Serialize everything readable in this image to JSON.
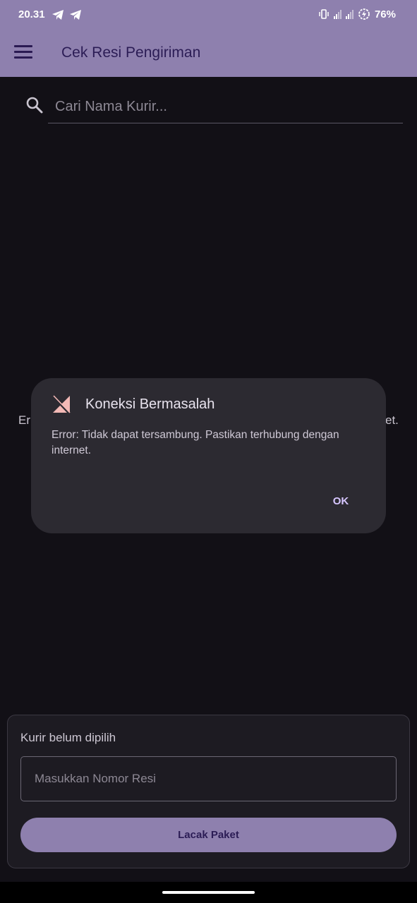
{
  "status_bar": {
    "time": "20.31",
    "battery": "76%"
  },
  "app_bar": {
    "title": "Cek Resi Pengiriman",
    "menu_icon": "menu-icon"
  },
  "search": {
    "placeholder": "Cari Nama Kurir...",
    "icon": "search-icon"
  },
  "background_error": {
    "left_fragment": "Er",
    "right_fragment": "et."
  },
  "dialog": {
    "icon": "no-signal-icon",
    "title": "Koneksi Bermasalah",
    "message": "Error: Tidak dapat tersambung. Pastikan terhubung dengan internet.",
    "ok_label": "OK"
  },
  "bottom_card": {
    "courier_status": "Kurir belum dipilih",
    "resi_placeholder": "Masukkan Nomor Resi",
    "track_label": "Lacak Paket"
  },
  "colors": {
    "accent": "#8e80ae",
    "background": "#121016",
    "dialog_bg": "#2c2a31"
  }
}
